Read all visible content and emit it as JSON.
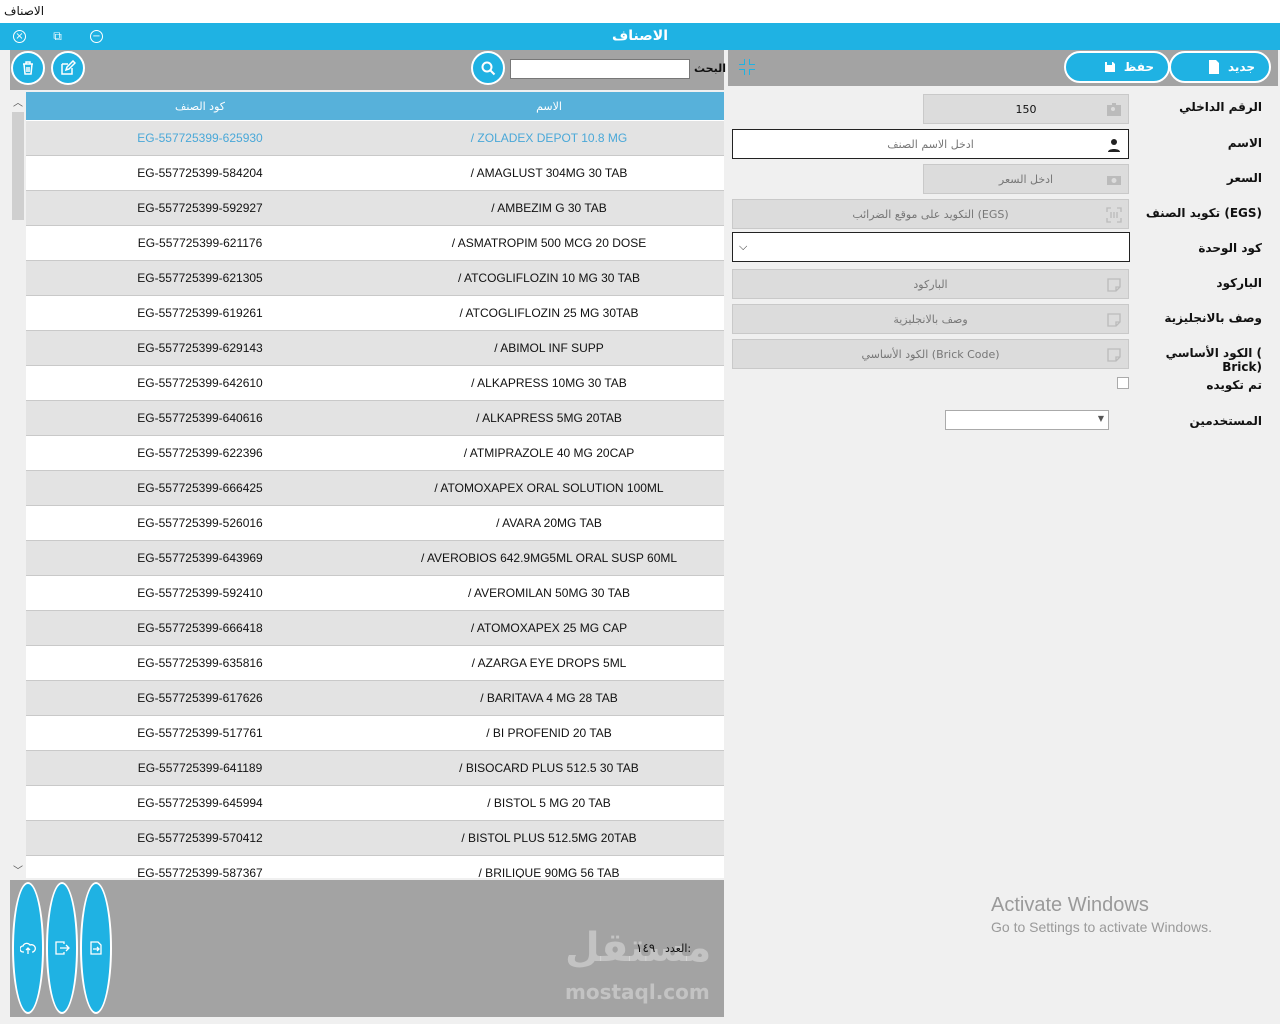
{
  "os_window": {
    "title": "الاصناف"
  },
  "app_bar": {
    "title": "الاصناف"
  },
  "list_toolbar": {
    "search_label": "البحث",
    "search_value": ""
  },
  "form_toolbar": {
    "new_label": "جديد",
    "save_label": "حفظ"
  },
  "table": {
    "headers": {
      "name": "الاسم",
      "code": "كود الصنف"
    },
    "rows": [
      {
        "name": "/ ZOLADEX DEPOT 10.8 MG",
        "code": "EG-557725399-625930"
      },
      {
        "name": "/ AMAGLUST 304MG 30 TAB",
        "code": "EG-557725399-584204"
      },
      {
        "name": "/ AMBEZIM G 30 TAB",
        "code": "EG-557725399-592927"
      },
      {
        "name": "/ ASMATROPIM 500 MCG 20 DOSE",
        "code": "EG-557725399-621176"
      },
      {
        "name": "/ ATCOGLIFLOZIN 10 MG 30 TAB",
        "code": "EG-557725399-621305"
      },
      {
        "name": "/ ATCOGLIFLOZIN 25 MG 30TAB",
        "code": "EG-557725399-619261"
      },
      {
        "name": "/ ABIMOL INF SUPP",
        "code": "EG-557725399-629143"
      },
      {
        "name": "/ ALKAPRESS 10MG 30 TAB",
        "code": "EG-557725399-642610"
      },
      {
        "name": "/ ALKAPRESS 5MG 20TAB",
        "code": "EG-557725399-640616"
      },
      {
        "name": "/ ATMIPRAZOLE 40 MG 20CAP",
        "code": "EG-557725399-622396"
      },
      {
        "name": "/ ATOMOXAPEX ORAL SOLUTION 100ML",
        "code": "EG-557725399-666425"
      },
      {
        "name": "/ AVARA 20MG TAB",
        "code": "EG-557725399-526016"
      },
      {
        "name": "/ AVEROBIOS 642.9MG5ML ORAL SUSP 60ML",
        "code": "EG-557725399-643969"
      },
      {
        "name": "/ AVEROMILAN 50MG 30 TAB",
        "code": "EG-557725399-592410"
      },
      {
        "name": "/ ATOMOXAPEX 25 MG CAP",
        "code": "EG-557725399-666418"
      },
      {
        "name": "/ AZARGA EYE DROPS 5ML",
        "code": "EG-557725399-635816"
      },
      {
        "name": "/ BARITAVA 4 MG 28 TAB",
        "code": "EG-557725399-617626"
      },
      {
        "name": "/ BI PROFENID 20 TAB",
        "code": "EG-557725399-517761"
      },
      {
        "name": "/ BISOCARD PLUS 512.5 30 TAB",
        "code": "EG-557725399-641189"
      },
      {
        "name": "/ BISTOL 5 MG 20 TAB",
        "code": "EG-557725399-645994"
      },
      {
        "name": "/ BISTOL PLUS 512.5MG 20TAB",
        "code": "EG-557725399-570412"
      },
      {
        "name": "/ BRILIQUE 90MG 56 TAB",
        "code": "EG-557725399-587367"
      }
    ]
  },
  "footer": {
    "count_label": "العدد:",
    "count_value": "١٤٩",
    "watermark_ar": "مستقل",
    "watermark_url": "mostaql.com"
  },
  "form": {
    "internal_no": {
      "label": "الرقم الداخلي",
      "value": "150"
    },
    "name": {
      "label": "الاسم",
      "placeholder": "ادخل الاسم الصنف"
    },
    "price": {
      "label": "السعر",
      "placeholder": "ادخل السعر"
    },
    "egs_code": {
      "label": "تكويد الصنف (EGS)",
      "placeholder": "التكويد على موقع الضرائب (EGS)"
    },
    "unit_code": {
      "label": "كود الوحدة",
      "value": ""
    },
    "barcode": {
      "label": "الباركود",
      "placeholder": "الباركود"
    },
    "english_desc": {
      "label": "وصف بالانجليزية",
      "placeholder": "وصف بالانجليزية"
    },
    "brick_code": {
      "label": "الكود الأساسي ( Brick)",
      "placeholder": "الكود الأساسي (Brick Code)"
    },
    "coded": {
      "label": "تم تكويده",
      "checked": false
    },
    "users": {
      "label": "المستخدمين",
      "value": ""
    }
  },
  "system": {
    "activate_title": "Activate Windows",
    "activate_sub": "Go to Settings to activate Windows."
  },
  "icons": [
    "close-icon",
    "restore-icon",
    "minimize-icon",
    "delete-icon",
    "edit-icon",
    "search-icon",
    "new-document-icon",
    "save-icon",
    "collapse-icon",
    "upload-icon",
    "export-icon",
    "import-icon"
  ],
  "colors": {
    "accent": "#1fb2e3",
    "header": "#57b1da",
    "panel": "#a3a3a3",
    "selected_text": "#4aa8d8"
  }
}
